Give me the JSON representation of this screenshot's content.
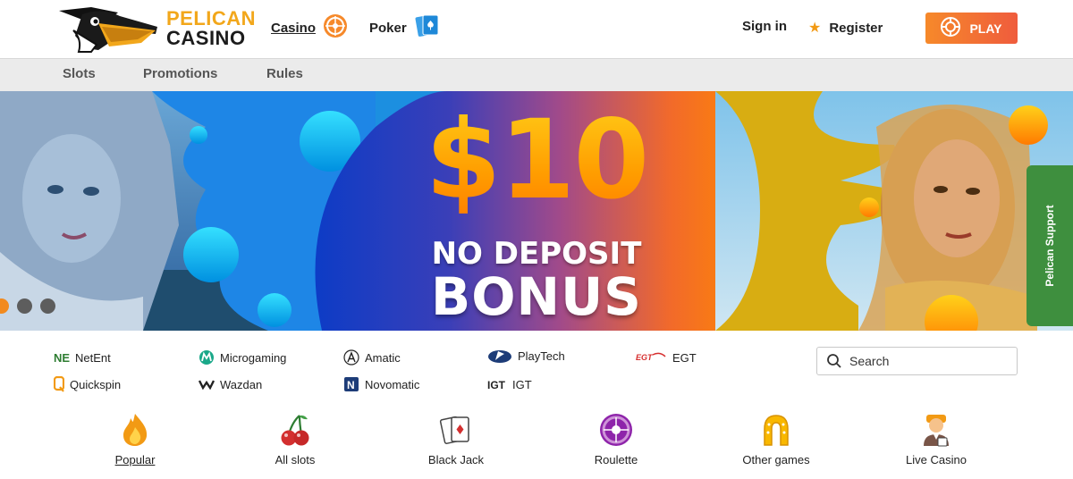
{
  "header": {
    "logo": {
      "line1": "PELICAN",
      "line2": "CASINO"
    },
    "nav": [
      {
        "label": "Casino",
        "icon": "roulette-wheel-icon",
        "active": true
      },
      {
        "label": "Poker",
        "icon": "playing-cards-icon",
        "active": false
      }
    ],
    "sign_in": "Sign in",
    "register": "Register",
    "play": "PLAY"
  },
  "subnav": {
    "items": [
      "Slots",
      "Promotions",
      "Rules"
    ]
  },
  "banner": {
    "amount": "$10",
    "line2": "NO DEPOSIT",
    "line3": "BONUS",
    "slides": 3,
    "active_slide": 0
  },
  "support": {
    "label": "Pelican Support"
  },
  "providers": [
    {
      "name": "NetEnt",
      "icon": "netent-logo-icon"
    },
    {
      "name": "Microgaming",
      "icon": "microgaming-logo-icon"
    },
    {
      "name": "Amatic",
      "icon": "amatic-logo-icon"
    },
    {
      "name": "PlayTech",
      "icon": "playtech-logo-icon"
    },
    {
      "name": "EGT",
      "icon": "egt-logo-icon"
    },
    {
      "name": "Quickspin",
      "icon": "quickspin-logo-icon"
    },
    {
      "name": "Wazdan",
      "icon": "wazdan-logo-icon"
    },
    {
      "name": "Novomatic",
      "icon": "novomatic-logo-icon"
    },
    {
      "name": "IGT",
      "icon": "igt-logo-icon"
    }
  ],
  "search": {
    "placeholder": "Search"
  },
  "categories": [
    {
      "label": "Popular",
      "icon": "flame-icon",
      "active": true
    },
    {
      "label": "All slots",
      "icon": "cherries-icon",
      "active": false
    },
    {
      "label": "Black Jack",
      "icon": "cards-icon",
      "active": false
    },
    {
      "label": "Roulette",
      "icon": "roulette-icon",
      "active": false
    },
    {
      "label": "Other games",
      "icon": "horseshoe-icon",
      "active": false
    },
    {
      "label": "Live Casino",
      "icon": "dealer-icon",
      "active": false
    }
  ],
  "colors": {
    "accent": "#f2a71b",
    "play_gradient_start": "#f6892a",
    "play_gradient_end": "#ef5c3d",
    "support_green": "#3e8f3e",
    "subnav_bg": "#ebebeb"
  }
}
